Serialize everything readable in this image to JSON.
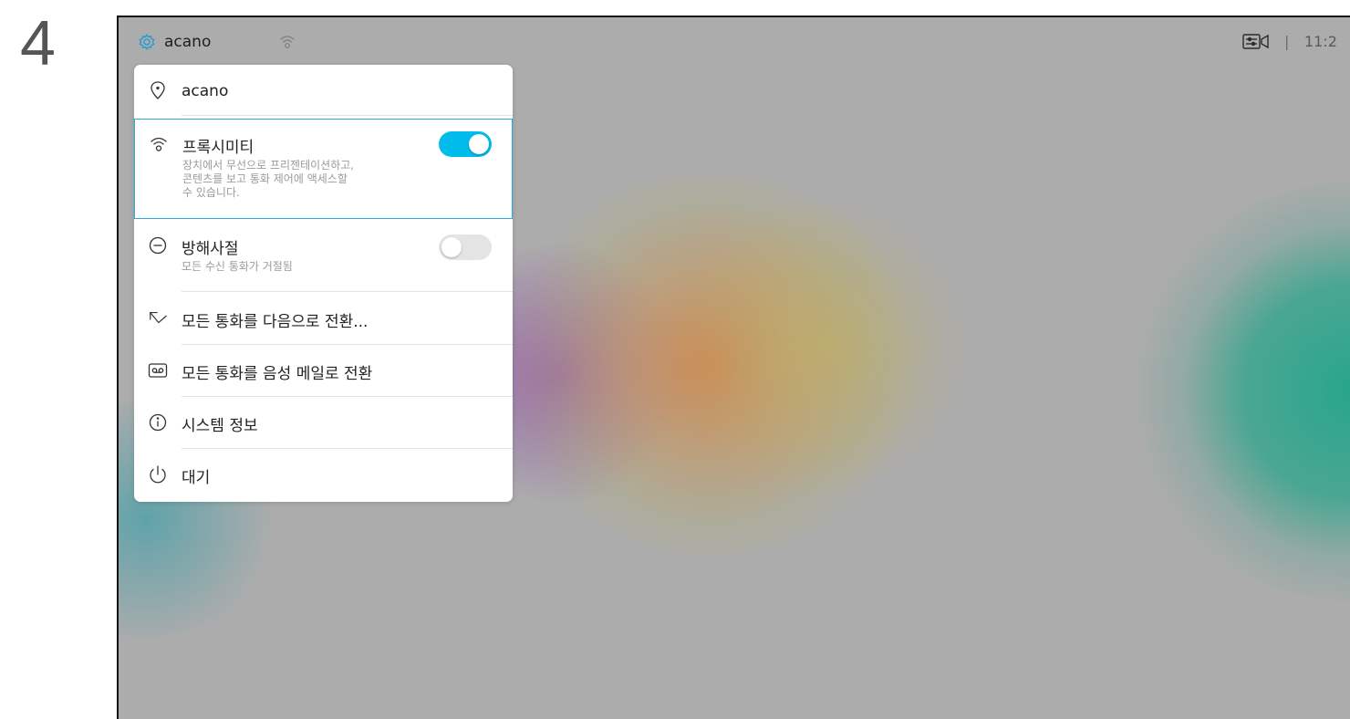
{
  "step": "4",
  "topbar": {
    "device_name": "acano",
    "separator": "|",
    "clock": "11:2",
    "icons": [
      "gear-icon",
      "proximity-icon",
      "camera-icon"
    ]
  },
  "menu": {
    "location": {
      "label": "acano",
      "icon": "location-pin-icon"
    },
    "proximity": {
      "label": "프록시미티",
      "description": [
        "장치에서 무선으로 프리젠테이션하고,",
        "콘텐츠를 보고 통화 제어에 액세스할",
        "수 있습니다."
      ],
      "toggle": "on",
      "icon": "proximity-icon"
    },
    "dnd": {
      "label": "방해사절",
      "description": "모든 수신 통화가 거절됨",
      "toggle": "off",
      "icon": "minus-circle-icon"
    },
    "forward": {
      "label": "모든 통화를 다음으로 전환...",
      "icon": "forward-arrow-icon"
    },
    "voicemail": {
      "label": "모든 통화를 음성 메일로 전환",
      "icon": "voicemail-icon"
    },
    "info": {
      "label": "시스템 정보",
      "icon": "info-icon"
    },
    "standby": {
      "label": "대기",
      "icon": "power-icon"
    }
  },
  "colors": {
    "accent": "#00bceb",
    "selection_border": "#27a9e1",
    "background": "#acacac"
  }
}
